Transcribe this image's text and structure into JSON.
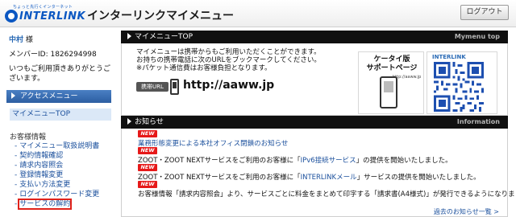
{
  "header": {
    "logo_tagline": "ちょっと先行くインターネット",
    "logo_word": "INTERLINK",
    "title": "インターリンクマイメニュー",
    "logout_label": "ログアウト"
  },
  "sidebar": {
    "user_name": "中村",
    "user_suffix": " 様",
    "member_id_label": "メンバーID: ",
    "member_id_value": "1826294998",
    "thanks": "いつもご利用頂きありがとうございます。",
    "access_menu_label": "アクセスメニュー",
    "menu_top_label": "マイメニューTOP",
    "section_label": "お客様情報",
    "items": [
      {
        "label": "マイメニュー取扱説明書"
      },
      {
        "label": "契約情報確認"
      },
      {
        "label": "請求内容照会"
      },
      {
        "label": "登録情報変更"
      },
      {
        "label": "支払い方法変更"
      },
      {
        "label": "ログインパスワード変更"
      },
      {
        "label": "サービスの解約",
        "highlighted": true
      }
    ]
  },
  "mymenu": {
    "head_label": "マイメニューTOP",
    "head_sub": "Mymenu top",
    "line1": "マイメニューは携帯からもご利用いただくことができます。",
    "line2": "お持ちの携帯電話に次のURLをブックマークしてください。",
    "line3": "※パケット通信費はお客様負担となります。",
    "mobile_badge": "携帯URL",
    "mobile_url": "http://aaww.jp",
    "keitai_title_1": "ケータイ版",
    "keitai_title_2": "サポートページ",
    "keitai_url": "http://aaww.jp",
    "qr_label": "INTERLINK"
  },
  "news": {
    "head_label": "お知らせ",
    "head_sub": "Information",
    "new_label": "NEW",
    "items": [
      {
        "text": "業務形態変更による本社オフィス閉鎖のお知らせ",
        "type": "link"
      },
      {
        "pre": "ZOOT・ZOOT NEXTサービスをご利用のお客様に「",
        "hl": "IPv6接続サービス",
        "post": "」の提供を開始いたしました。"
      },
      {
        "pre": "ZOOT・ZOOT NEXTサービスをご利用のお客様に「",
        "hl": "INTERLINKメール",
        "post": "」サービスの提供を開始いたしました。"
      },
      {
        "text": "お客様情報「請求内容照会」より、サービスごとに料金をまとめて印字する「請求書(A4様式)」が発行できるようになりました。",
        "type": "plain"
      }
    ],
    "more_label": "過去のお知らせ一覧 >"
  },
  "colors": {
    "accent": "#0b57c2",
    "link": "#1a4f9c",
    "new_badge": "#e61919",
    "panel_head": "#101010",
    "highlight_box": "#e0221b"
  }
}
